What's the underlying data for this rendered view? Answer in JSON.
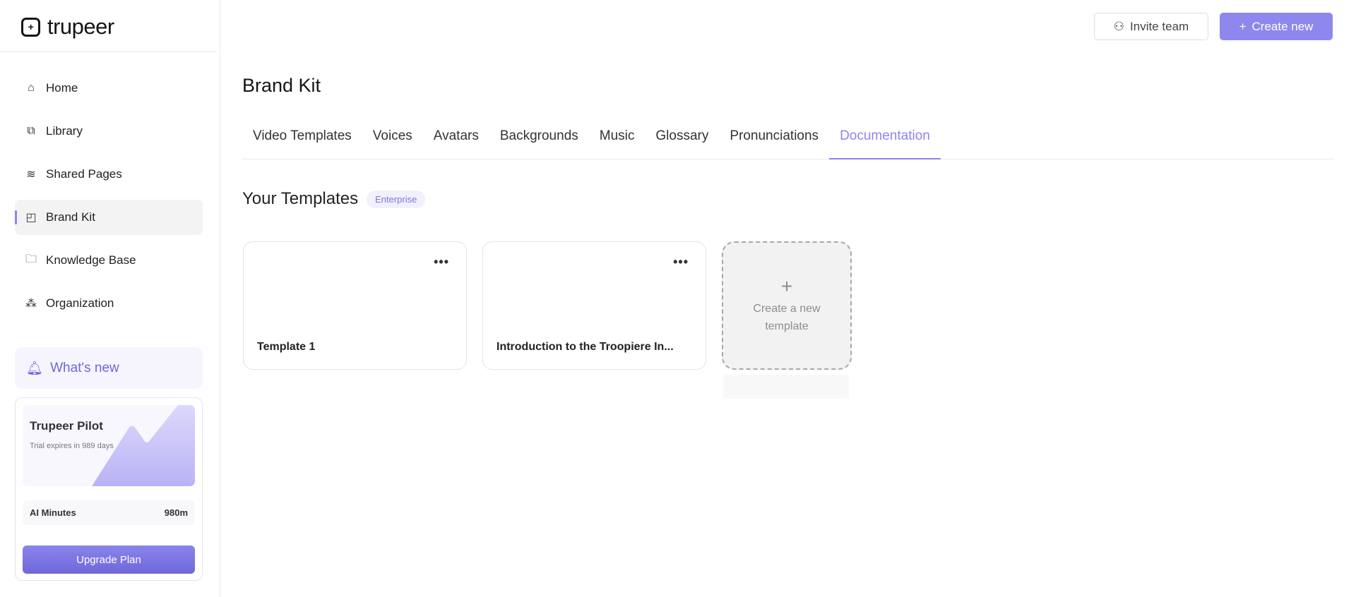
{
  "brand": {
    "name": "trupeer"
  },
  "sidebar": {
    "items": [
      {
        "label": "Home",
        "icon": "home-icon"
      },
      {
        "label": "Library",
        "icon": "library-icon"
      },
      {
        "label": "Shared Pages",
        "icon": "layers-icon"
      },
      {
        "label": "Brand Kit",
        "icon": "brand-kit-icon"
      },
      {
        "label": "Knowledge Base",
        "icon": "folder-icon"
      },
      {
        "label": "Organization",
        "icon": "organization-icon"
      }
    ],
    "whats_new": "What's new",
    "plan": {
      "title": "Trupeer Pilot",
      "subtitle": "Trial expires in 989 days",
      "minutes_label": "AI Minutes",
      "minutes_value": "980m",
      "upgrade": "Upgrade Plan"
    }
  },
  "header": {
    "invite": "Invite team",
    "create": "Create new"
  },
  "page": {
    "title": "Brand Kit",
    "tabs": [
      "Video Templates",
      "Voices",
      "Avatars",
      "Backgrounds",
      "Music",
      "Glossary",
      "Pronunciations",
      "Documentation"
    ],
    "active_tab": "Documentation",
    "section_title": "Your Templates",
    "badge": "Enterprise",
    "templates": [
      {
        "name": "Template 1"
      },
      {
        "name": "Introduction to the Troopiere In..."
      }
    ],
    "create_template": "Create a new template"
  },
  "colors": {
    "accent": "#8f84ef"
  }
}
